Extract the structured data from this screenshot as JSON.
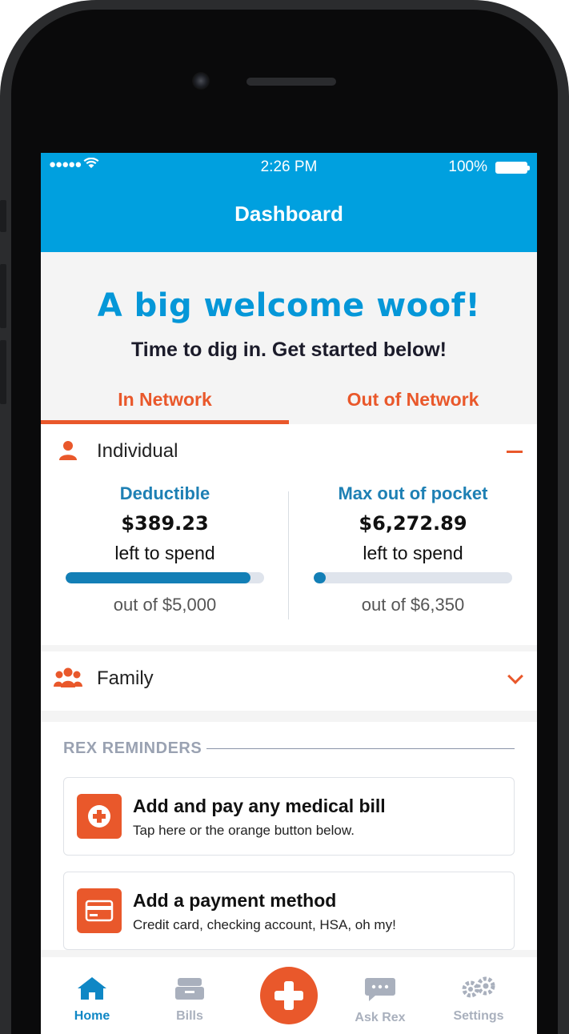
{
  "status": {
    "signal": "●●●●● ",
    "time": "2:26 PM",
    "battery": "100%"
  },
  "navbar": {
    "title": "Dashboard"
  },
  "welcome": {
    "title": "A big welcome woof!",
    "subtitle": "Time to dig in. Get started below!"
  },
  "tabs": [
    {
      "label": "In Network",
      "active": true
    },
    {
      "label": "Out of Network",
      "active": false
    }
  ],
  "individual": {
    "label": "Individual",
    "deductible": {
      "title": "Deductible",
      "value": "$389.23",
      "note": "left to spend",
      "total": "out of $5,000",
      "progress": 0.93
    },
    "max_oop": {
      "title": "Max out of pocket",
      "value": "$6,272.89",
      "note": "left to spend",
      "total": "out of $6,350",
      "progress": 0.06
    }
  },
  "family": {
    "label": "Family"
  },
  "reminders": {
    "title": "REX REMINDERS",
    "cards": [
      {
        "title": "Add and pay any medical bill",
        "subtitle": "Tap here or the orange button below.",
        "icon": "plus-circle-icon"
      },
      {
        "title": "Add a payment method",
        "subtitle": "Credit card, checking account, HSA, oh my!",
        "icon": "credit-card-icon"
      }
    ]
  },
  "tabbar": {
    "home": "Home",
    "bills": "Bills",
    "ask": "Ask Rex",
    "settings": "Settings"
  },
  "colors": {
    "brand_blue": "#00a0df",
    "accent_orange": "#e9582b"
  }
}
